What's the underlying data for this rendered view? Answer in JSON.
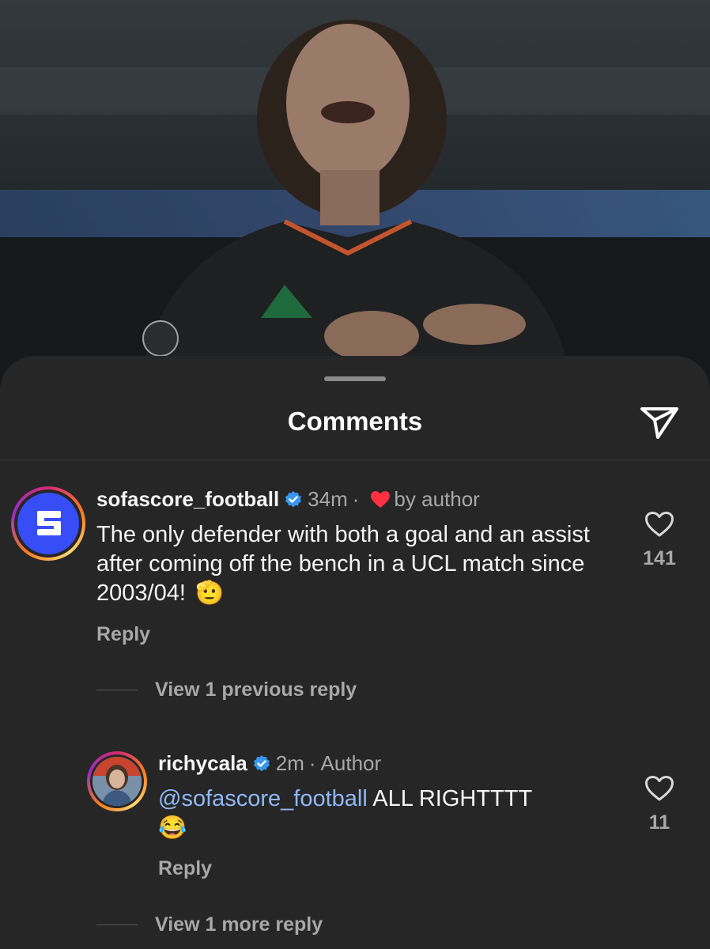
{
  "header": {
    "title": "Comments"
  },
  "comments": [
    {
      "username": "sofascore_football",
      "time": "34m",
      "separator": "·",
      "liked_by_author": "by author",
      "text": "The only defender with both a goal and an assist after coming off the bench in a UCL match since 2003/04!",
      "emoji": "🫡",
      "like_count": "141",
      "reply_label": "Reply",
      "view_replies": "View 1 previous reply"
    },
    {
      "username": "richycala",
      "time": "2m",
      "separator": "·",
      "author_tag": "Author",
      "mention": "@sofascore_football",
      "text": " ALL RIGHTTTT",
      "emoji": "😂",
      "like_count": "11",
      "reply_label": "Reply",
      "view_replies": "View 1 more reply"
    }
  ],
  "colors": {
    "sheet_bg": "#262626",
    "text_primary": "#f5f5f5",
    "text_secondary": "#a8a8a8",
    "mention": "#8fb8f5",
    "verified": "#3897f0",
    "heart_red": "#ff3040",
    "sofascore_blue": "#374df5"
  },
  "icons": {
    "share": "send-paper-plane-icon",
    "like": "heart-outline-icon",
    "verified": "verified-badge-icon"
  }
}
